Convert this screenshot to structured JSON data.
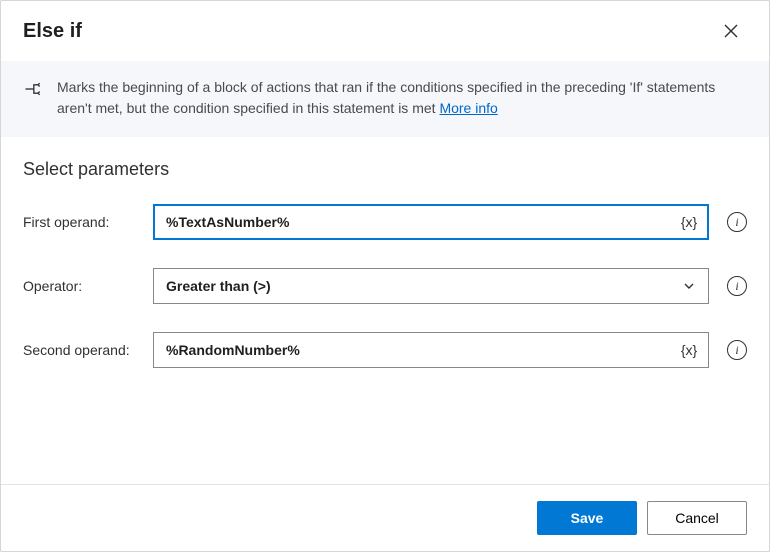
{
  "dialog": {
    "title": "Else if",
    "description": "Marks the beginning of a block of actions that ran if the conditions specified in the preceding 'If' statements aren't met, but the condition specified in this statement is met ",
    "more_info_label": "More info"
  },
  "section": {
    "title": "Select parameters"
  },
  "params": {
    "first_operand": {
      "label": "First operand:",
      "value": "%TextAsNumber%",
      "var_affordance": "{x}"
    },
    "operator": {
      "label": "Operator:",
      "value": "Greater than (>)"
    },
    "second_operand": {
      "label": "Second operand:",
      "value": "%RandomNumber%",
      "var_affordance": "{x}"
    }
  },
  "footer": {
    "save": "Save",
    "cancel": "Cancel"
  }
}
